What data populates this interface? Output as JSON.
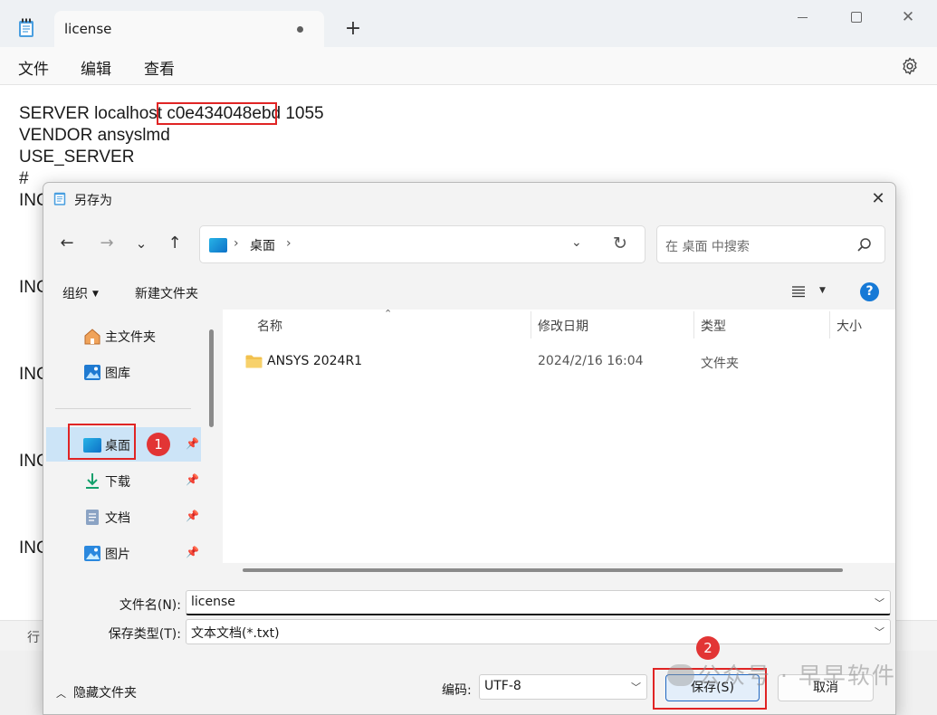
{
  "notepad": {
    "tab_title": "license",
    "new_tab": "+",
    "close_glyph": "✕",
    "menu": [
      "文件",
      "编辑",
      "查看"
    ],
    "lines": [
      "SERVER localhost c0e434048ebd 1055",
      "VENDOR ansyslmd",
      "USE_SERVER",
      "#",
      "INC",
      "INC",
      "INC",
      "INC",
      "INC"
    ],
    "status_text": "行"
  },
  "dialog": {
    "title": "另存为",
    "close_glyph": "✕",
    "nav": {
      "back": "←",
      "forward": "→",
      "recent": "⌄",
      "up": "↑"
    },
    "address": {
      "separator": "›",
      "location": "桌面",
      "dropdown": "⌄",
      "refresh": "↻"
    },
    "search_placeholder": "在 桌面 中搜索",
    "commands": {
      "organize": "组织",
      "new_folder": "新建文件夹"
    },
    "help": "?",
    "nav_pane": {
      "items": [
        {
          "label": "主文件夹",
          "icon": "home-icon"
        },
        {
          "label": "图库",
          "icon": "gallery-icon"
        },
        {
          "label": "桌面",
          "icon": "desktop-icon",
          "selected": true,
          "pinned": true
        },
        {
          "label": "下载",
          "icon": "download-icon",
          "pinned": true
        },
        {
          "label": "文档",
          "icon": "document-icon",
          "pinned": true
        },
        {
          "label": "图片",
          "icon": "pictures-icon",
          "pinned": true
        }
      ]
    },
    "columns": [
      "名称",
      "修改日期",
      "类型",
      "大小"
    ],
    "files": [
      {
        "name": "ANSYS 2024R1",
        "modified": "2024/2/16 16:04",
        "type": "文件夹"
      }
    ],
    "filename_label": "文件名(N):",
    "filename_value": "license",
    "filetype_label": "保存类型(T):",
    "filetype_value": "文本文档(*.txt)",
    "hide_folders": "隐藏文件夹",
    "encoding_label": "编码:",
    "encoding_value": "UTF-8",
    "save_button": "保存(S)",
    "cancel_button": "取消"
  },
  "annotations": {
    "badge_1": "1",
    "badge_2": "2",
    "highlight_color": "#e02424"
  },
  "watermark": "公众号 · 早早软件",
  "colors": {
    "accent": "#1679d6",
    "selection": "#cce4f7",
    "folder": "#f2c14e"
  }
}
